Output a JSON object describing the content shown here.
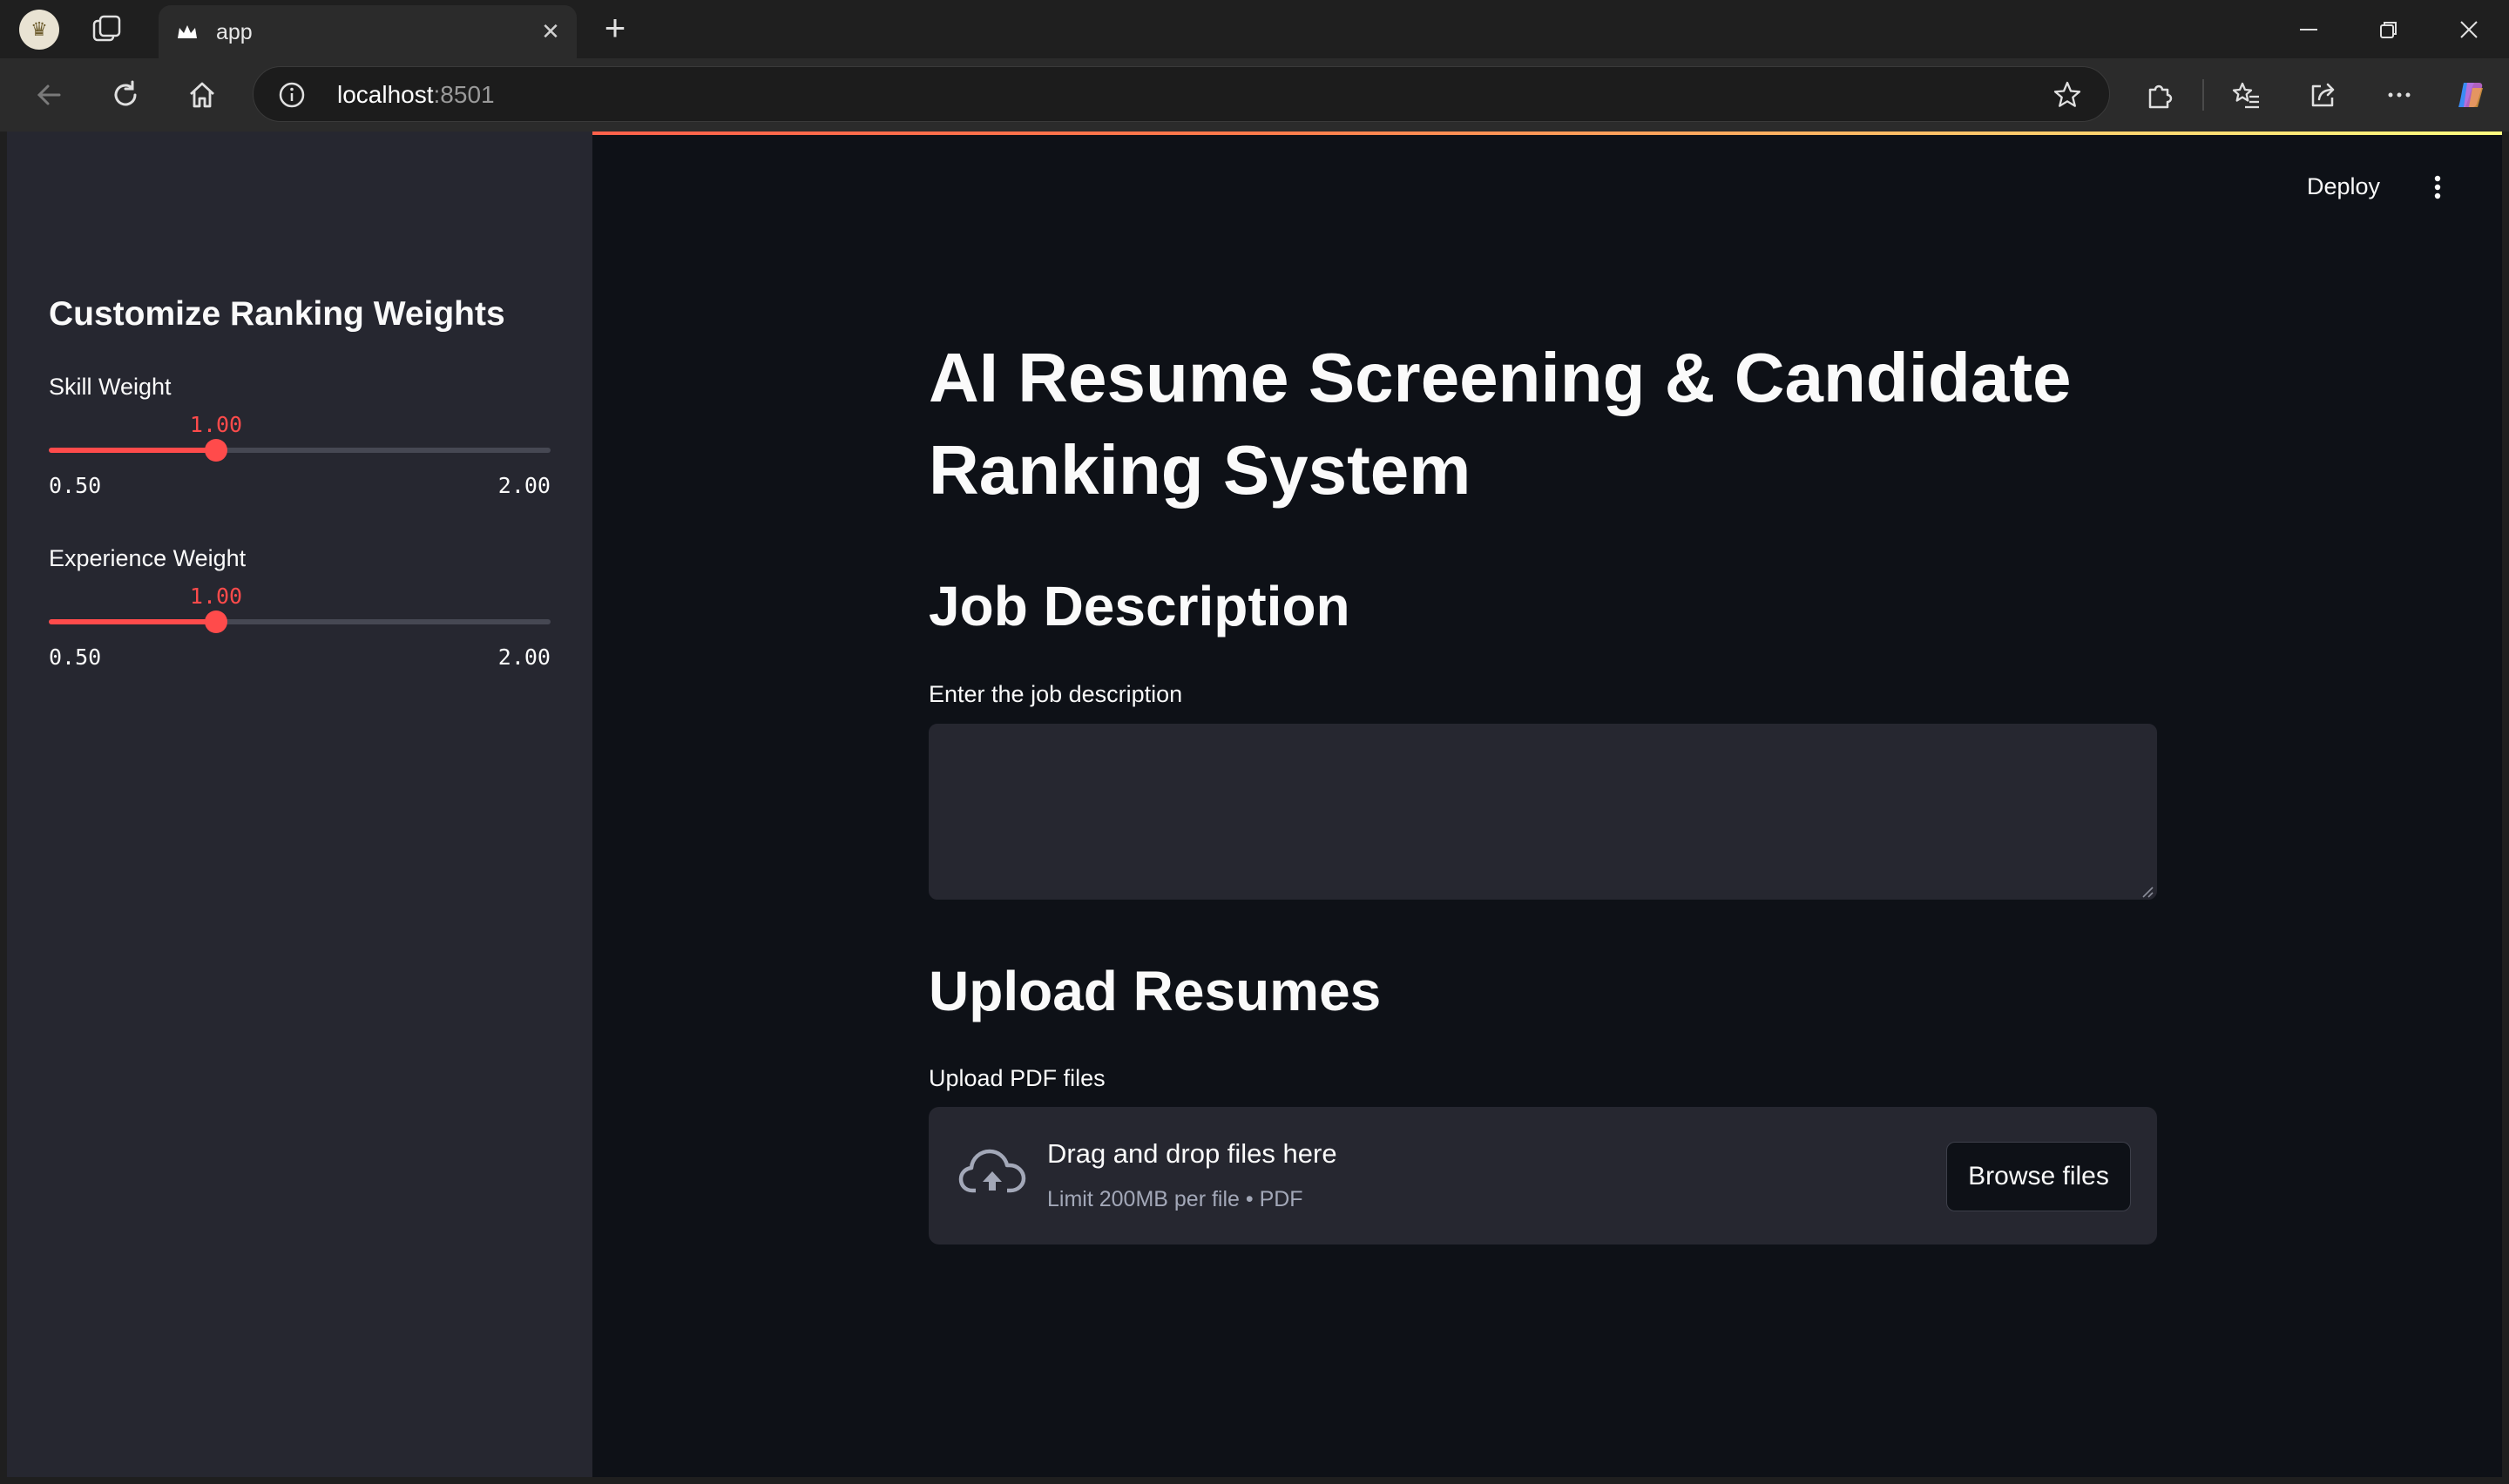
{
  "browser": {
    "tab_title": "app",
    "address_host": "localhost",
    "address_port": ":8501"
  },
  "sidebar": {
    "title": "Customize Ranking Weights",
    "sliders": [
      {
        "label": "Skill Weight",
        "value": "1.00",
        "min": "0.50",
        "max": "2.00",
        "fraction": 0.3333
      },
      {
        "label": "Experience Weight",
        "value": "1.00",
        "min": "0.50",
        "max": "2.00",
        "fraction": 0.3333
      }
    ]
  },
  "header": {
    "deploy_label": "Deploy"
  },
  "main": {
    "title": "AI Resume Screening & Candidate Ranking System",
    "job_section": {
      "heading": "Job Description",
      "input_label": "Enter the job description",
      "input_value": ""
    },
    "upload_section": {
      "heading": "Upload Resumes",
      "input_label": "Upload PDF files",
      "dropzone_title": "Drag and drop files here",
      "dropzone_subtitle": "Limit 200MB per file • PDF",
      "browse_label": "Browse files"
    }
  },
  "colors": {
    "accent": "#ff4b4b",
    "background": "#0e1117",
    "sidebar": "#262730"
  }
}
